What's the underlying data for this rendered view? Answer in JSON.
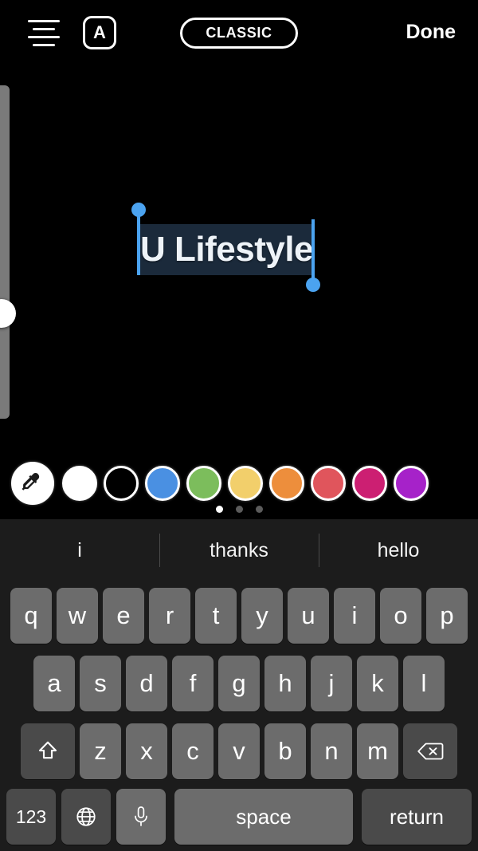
{
  "topbar": {
    "align_icon": "text-align-center-icon",
    "letter_box_label": "A",
    "style_label": "CLASSIC",
    "done_label": "Done"
  },
  "canvas": {
    "text_value": "U Lifestyle",
    "selection_color": "#1b2a3b",
    "handle_color": "#4ba3f0",
    "text_color": "#eef3f8",
    "size_slider": {
      "name": "text-size-slider",
      "thumb_position_percent": 64
    }
  },
  "colors": {
    "swatches": [
      {
        "name": "eyedropper",
        "hex": "#ffffff"
      },
      {
        "name": "white",
        "hex": "#ffffff"
      },
      {
        "name": "black",
        "hex": "#000000"
      },
      {
        "name": "blue",
        "hex": "#4a90e2"
      },
      {
        "name": "green",
        "hex": "#7cbd5c"
      },
      {
        "name": "yellow",
        "hex": "#f2cf6b"
      },
      {
        "name": "orange",
        "hex": "#ed8e3c"
      },
      {
        "name": "red",
        "hex": "#e0555c"
      },
      {
        "name": "pink",
        "hex": "#cc1f72"
      },
      {
        "name": "purple",
        "hex": "#a622c9"
      }
    ],
    "page_dots": {
      "count": 3,
      "active_index": 0
    }
  },
  "keyboard": {
    "suggestions": [
      "i",
      "thanks",
      "hello"
    ],
    "row1": [
      "q",
      "w",
      "e",
      "r",
      "t",
      "y",
      "u",
      "i",
      "o",
      "p"
    ],
    "row2": [
      "a",
      "s",
      "d",
      "f",
      "g",
      "h",
      "j",
      "k",
      "l"
    ],
    "row3_letters": [
      "z",
      "x",
      "c",
      "v",
      "b",
      "n",
      "m"
    ],
    "shift_icon": "shift-arrow-icon",
    "backspace_icon": "backspace-delete-icon",
    "numbers_label": "123",
    "globe_icon": "globe-language-icon",
    "mic_icon": "microphone-icon",
    "space_label": "space",
    "return_label": "return"
  }
}
